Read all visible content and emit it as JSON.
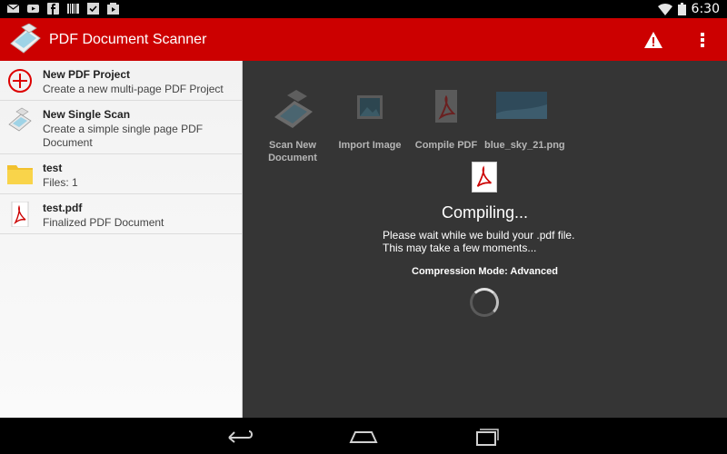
{
  "status_bar": {
    "time": "6:30",
    "left_icons": [
      "mail-icon",
      "youtube-icon",
      "facebook-icon",
      "barcode-icon",
      "checkbox-icon",
      "media-icon"
    ],
    "right_icons": [
      "wifi-icon",
      "battery-icon"
    ]
  },
  "action_bar": {
    "title": "PDF Document Scanner",
    "icons": [
      "scanner-logo-icon",
      "warning-icon",
      "overflow-menu-icon"
    ],
    "colors": {
      "background": "#cc0000",
      "text": "#ffffff"
    }
  },
  "drawer": {
    "items": [
      {
        "title": "New PDF Project",
        "subtitle": "Create a new multi-page PDF Project",
        "icon": "add-circle-icon"
      },
      {
        "title": "New Single Scan",
        "subtitle": "Create a simple single page PDF Document",
        "icon": "scanner-icon"
      },
      {
        "title": "test",
        "subtitle": "Files: 1",
        "icon": "folder-icon"
      },
      {
        "title": "test.pdf",
        "subtitle": "Finalized PDF Document",
        "icon": "pdf-file-icon"
      }
    ]
  },
  "main": {
    "tiles": [
      {
        "label": "Scan New Document",
        "icon": "scanner-icon"
      },
      {
        "label": "Import Image",
        "icon": "image-icon"
      },
      {
        "label": "Compile PDF",
        "icon": "pdf-file-icon"
      },
      {
        "label": "blue_sky_21.png",
        "icon": "image-thumbnail-icon"
      }
    ]
  },
  "compiling": {
    "title": "Compiling...",
    "message_line1": "Please wait while we build your .pdf file.",
    "message_line2": "This may take a few moments...",
    "mode": "Compression Mode: Advanced",
    "icon": "pdf-file-icon"
  },
  "nav_bar": {
    "icons": [
      "back-icon",
      "home-icon",
      "recents-icon"
    ]
  }
}
